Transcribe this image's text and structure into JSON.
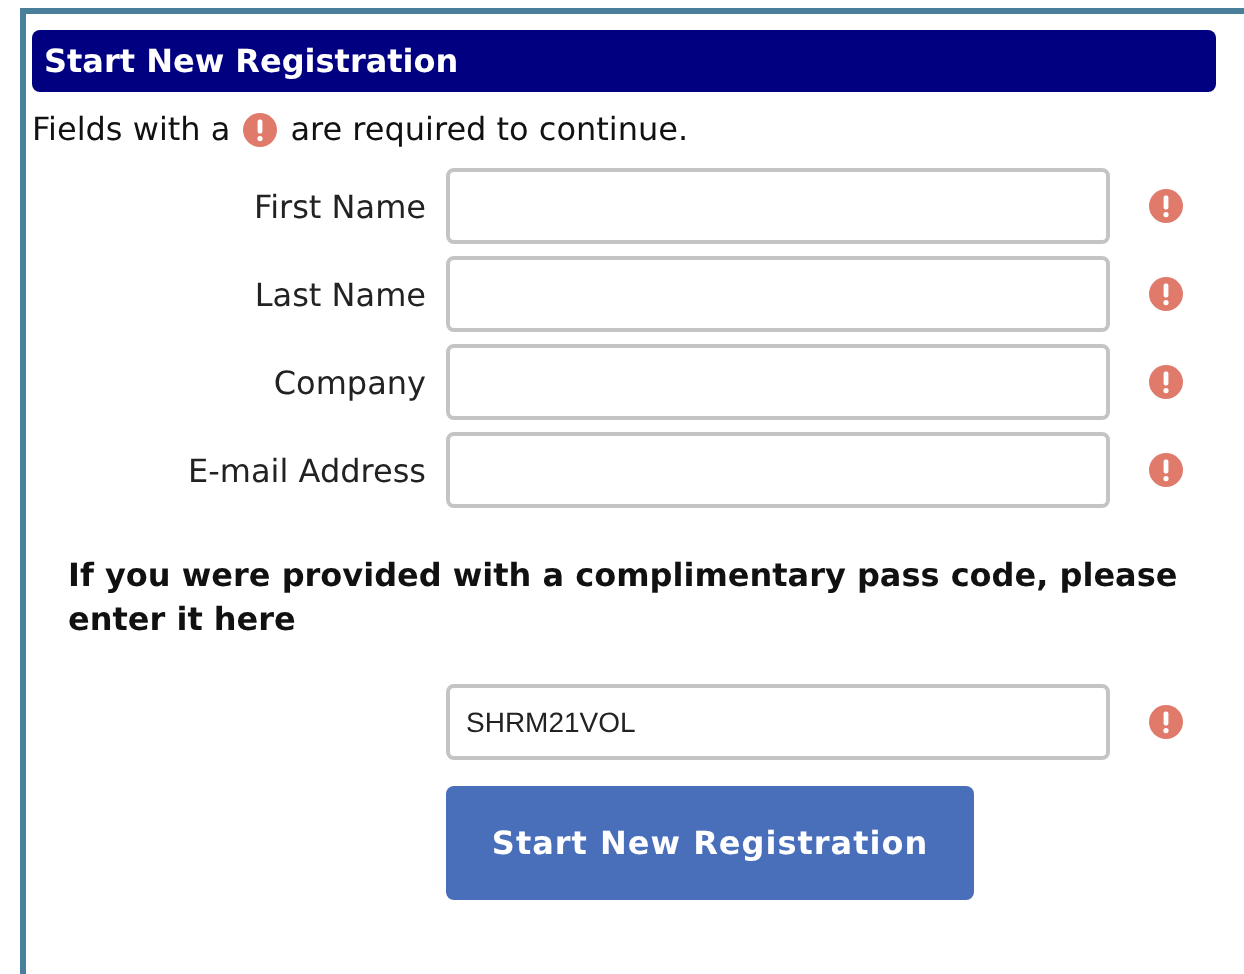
{
  "header": {
    "title": "Start New Registration"
  },
  "notice": {
    "before": "Fields with a",
    "after": "are required to continue."
  },
  "fields": [
    {
      "label": "First Name",
      "required": true
    },
    {
      "label": "Last Name",
      "required": true
    },
    {
      "label": "Company",
      "required": true
    },
    {
      "label": "E-mail Address",
      "required": true
    }
  ],
  "pass_code": {
    "prompt": "If you were provided with a complimentary pass code, please enter it here",
    "value": "SHRM21VOL",
    "required": true
  },
  "submit_button": {
    "label": "Start New Registration"
  }
}
